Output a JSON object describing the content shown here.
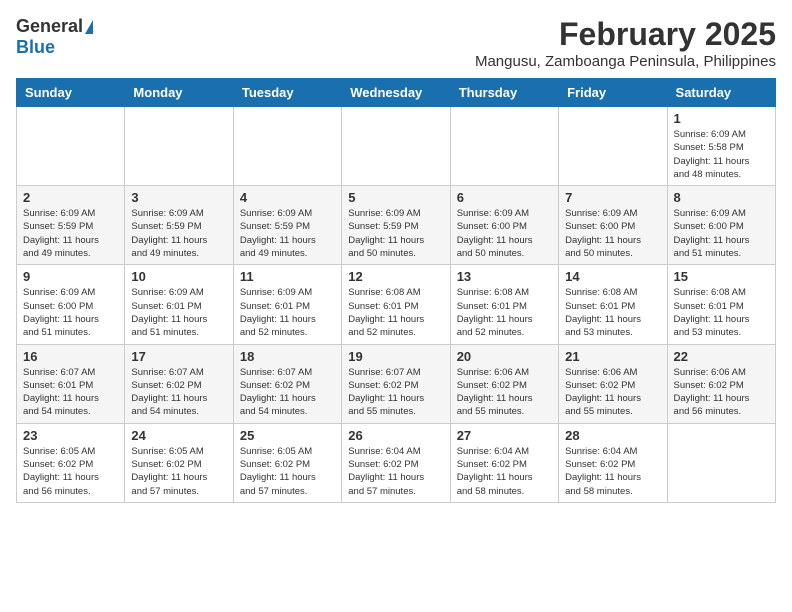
{
  "logo": {
    "general": "General",
    "blue": "Blue"
  },
  "title": "February 2025",
  "subtitle": "Mangusu, Zamboanga Peninsula, Philippines",
  "days_of_week": [
    "Sunday",
    "Monday",
    "Tuesday",
    "Wednesday",
    "Thursday",
    "Friday",
    "Saturday"
  ],
  "weeks": [
    [
      {
        "day": "",
        "info": ""
      },
      {
        "day": "",
        "info": ""
      },
      {
        "day": "",
        "info": ""
      },
      {
        "day": "",
        "info": ""
      },
      {
        "day": "",
        "info": ""
      },
      {
        "day": "",
        "info": ""
      },
      {
        "day": "1",
        "info": "Sunrise: 6:09 AM\nSunset: 5:58 PM\nDaylight: 11 hours\nand 48 minutes."
      }
    ],
    [
      {
        "day": "2",
        "info": "Sunrise: 6:09 AM\nSunset: 5:59 PM\nDaylight: 11 hours\nand 49 minutes."
      },
      {
        "day": "3",
        "info": "Sunrise: 6:09 AM\nSunset: 5:59 PM\nDaylight: 11 hours\nand 49 minutes."
      },
      {
        "day": "4",
        "info": "Sunrise: 6:09 AM\nSunset: 5:59 PM\nDaylight: 11 hours\nand 49 minutes."
      },
      {
        "day": "5",
        "info": "Sunrise: 6:09 AM\nSunset: 5:59 PM\nDaylight: 11 hours\nand 50 minutes."
      },
      {
        "day": "6",
        "info": "Sunrise: 6:09 AM\nSunset: 6:00 PM\nDaylight: 11 hours\nand 50 minutes."
      },
      {
        "day": "7",
        "info": "Sunrise: 6:09 AM\nSunset: 6:00 PM\nDaylight: 11 hours\nand 50 minutes."
      },
      {
        "day": "8",
        "info": "Sunrise: 6:09 AM\nSunset: 6:00 PM\nDaylight: 11 hours\nand 51 minutes."
      }
    ],
    [
      {
        "day": "9",
        "info": "Sunrise: 6:09 AM\nSunset: 6:00 PM\nDaylight: 11 hours\nand 51 minutes."
      },
      {
        "day": "10",
        "info": "Sunrise: 6:09 AM\nSunset: 6:01 PM\nDaylight: 11 hours\nand 51 minutes."
      },
      {
        "day": "11",
        "info": "Sunrise: 6:09 AM\nSunset: 6:01 PM\nDaylight: 11 hours\nand 52 minutes."
      },
      {
        "day": "12",
        "info": "Sunrise: 6:08 AM\nSunset: 6:01 PM\nDaylight: 11 hours\nand 52 minutes."
      },
      {
        "day": "13",
        "info": "Sunrise: 6:08 AM\nSunset: 6:01 PM\nDaylight: 11 hours\nand 52 minutes."
      },
      {
        "day": "14",
        "info": "Sunrise: 6:08 AM\nSunset: 6:01 PM\nDaylight: 11 hours\nand 53 minutes."
      },
      {
        "day": "15",
        "info": "Sunrise: 6:08 AM\nSunset: 6:01 PM\nDaylight: 11 hours\nand 53 minutes."
      }
    ],
    [
      {
        "day": "16",
        "info": "Sunrise: 6:07 AM\nSunset: 6:01 PM\nDaylight: 11 hours\nand 54 minutes."
      },
      {
        "day": "17",
        "info": "Sunrise: 6:07 AM\nSunset: 6:02 PM\nDaylight: 11 hours\nand 54 minutes."
      },
      {
        "day": "18",
        "info": "Sunrise: 6:07 AM\nSunset: 6:02 PM\nDaylight: 11 hours\nand 54 minutes."
      },
      {
        "day": "19",
        "info": "Sunrise: 6:07 AM\nSunset: 6:02 PM\nDaylight: 11 hours\nand 55 minutes."
      },
      {
        "day": "20",
        "info": "Sunrise: 6:06 AM\nSunset: 6:02 PM\nDaylight: 11 hours\nand 55 minutes."
      },
      {
        "day": "21",
        "info": "Sunrise: 6:06 AM\nSunset: 6:02 PM\nDaylight: 11 hours\nand 55 minutes."
      },
      {
        "day": "22",
        "info": "Sunrise: 6:06 AM\nSunset: 6:02 PM\nDaylight: 11 hours\nand 56 minutes."
      }
    ],
    [
      {
        "day": "23",
        "info": "Sunrise: 6:05 AM\nSunset: 6:02 PM\nDaylight: 11 hours\nand 56 minutes."
      },
      {
        "day": "24",
        "info": "Sunrise: 6:05 AM\nSunset: 6:02 PM\nDaylight: 11 hours\nand 57 minutes."
      },
      {
        "day": "25",
        "info": "Sunrise: 6:05 AM\nSunset: 6:02 PM\nDaylight: 11 hours\nand 57 minutes."
      },
      {
        "day": "26",
        "info": "Sunrise: 6:04 AM\nSunset: 6:02 PM\nDaylight: 11 hours\nand 57 minutes."
      },
      {
        "day": "27",
        "info": "Sunrise: 6:04 AM\nSunset: 6:02 PM\nDaylight: 11 hours\nand 58 minutes."
      },
      {
        "day": "28",
        "info": "Sunrise: 6:04 AM\nSunset: 6:02 PM\nDaylight: 11 hours\nand 58 minutes."
      },
      {
        "day": "",
        "info": ""
      }
    ]
  ]
}
